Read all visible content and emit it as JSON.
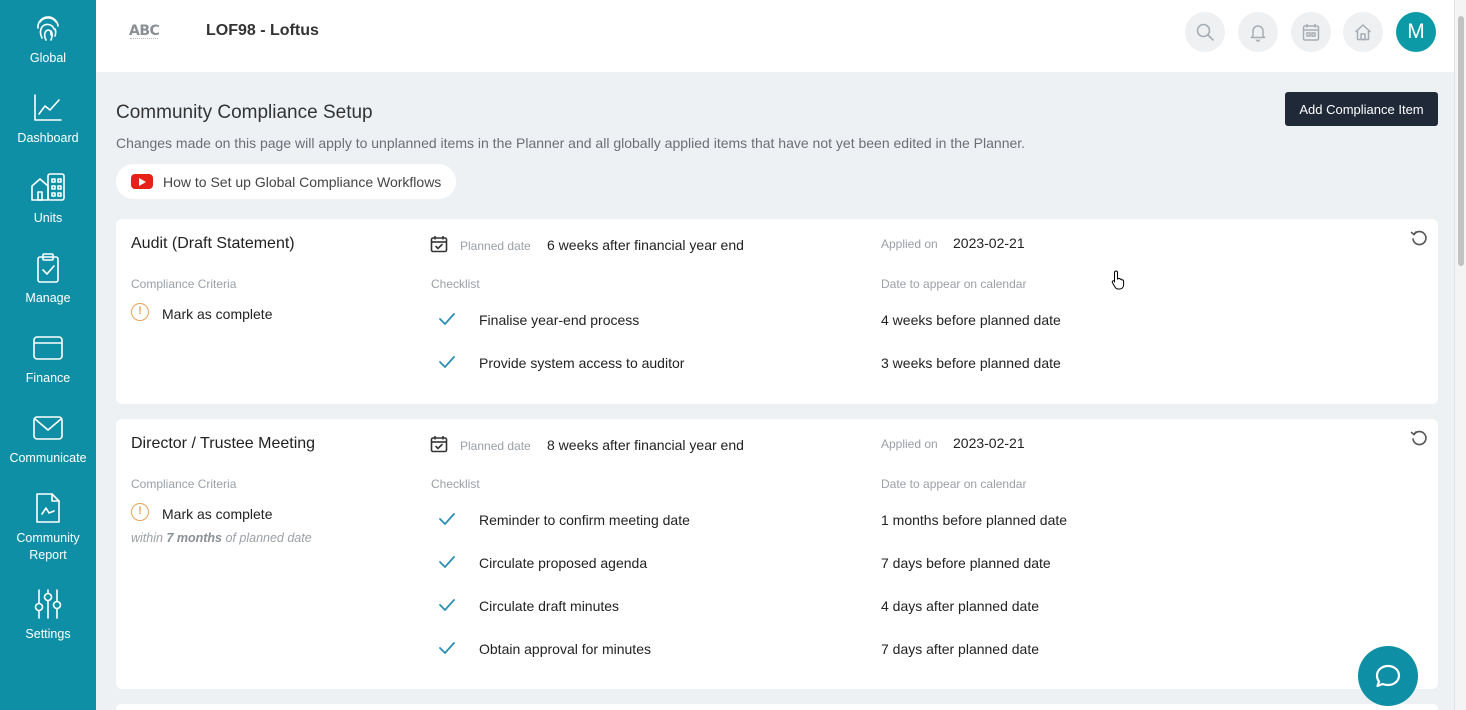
{
  "sidebar": {
    "items": [
      {
        "label": "Global",
        "icon": "fingerprint-icon"
      },
      {
        "label": "Dashboard",
        "icon": "chart-line-icon"
      },
      {
        "label": "Units",
        "icon": "buildings-icon"
      },
      {
        "label": "Manage",
        "icon": "clipboard-check-icon"
      },
      {
        "label": "Finance",
        "icon": "wallet-icon"
      },
      {
        "label": "Communicate",
        "icon": "envelope-icon"
      },
      {
        "label": "Community Report",
        "icon": "report-icon"
      },
      {
        "label": "Settings",
        "icon": "sliders-icon"
      }
    ]
  },
  "header": {
    "logo_text": "ABC",
    "org_title": "LOF98 - Loftus",
    "avatar_initial": "M"
  },
  "page": {
    "title": "Community Compliance Setup",
    "description": "Changes made on this page will apply to unplanned items in the Planner and all globally applied items that have not yet been edited in the Planner.",
    "add_button": "Add Compliance Item",
    "video_link": "How to Set up Global Compliance Workflows"
  },
  "labels": {
    "planned_date": "Planned date",
    "applied_on": "Applied on",
    "compliance_criteria": "Compliance Criteria",
    "checklist": "Checklist",
    "date_on_calendar": "Date to appear on calendar"
  },
  "cards": [
    {
      "title": "Audit (Draft Statement)",
      "planned_date": "6 weeks after financial year end",
      "applied_on": "2023-02-21",
      "criteria": "Mark as complete",
      "checklist": [
        {
          "item": "Finalise year-end process",
          "date": "4 weeks before planned date"
        },
        {
          "item": "Provide system access to auditor",
          "date": "3 weeks before planned date"
        }
      ]
    },
    {
      "title": "Director / Trustee Meeting",
      "planned_date": "8 weeks after financial year end",
      "applied_on": "2023-02-21",
      "criteria": "Mark as complete",
      "within_prefix": "within",
      "within_value": "7 months",
      "within_suffix": "of planned date",
      "checklist": [
        {
          "item": "Reminder to confirm meeting date",
          "date": "1 months before planned date"
        },
        {
          "item": "Circulate proposed agenda",
          "date": "7 days before planned date"
        },
        {
          "item": "Circulate draft minutes",
          "date": "4 days after planned date"
        },
        {
          "item": "Obtain approval for minutes",
          "date": "7 days after planned date"
        }
      ]
    }
  ],
  "colors": {
    "sidebar": "#0f8fa5",
    "primary_button": "#1f2937",
    "avatar": "#0b9aa6",
    "warning": "#e8a25c",
    "check": "#2a8fb0"
  }
}
